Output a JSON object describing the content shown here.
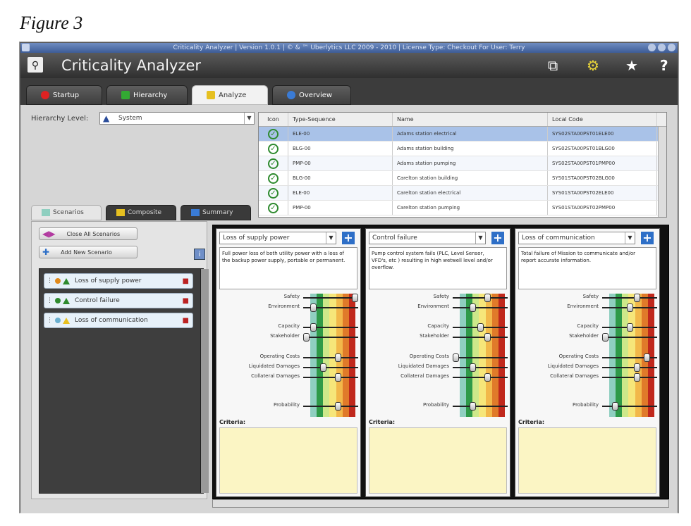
{
  "figure_caption": "Figure 3",
  "window": {
    "titlebar_text": "Criticality Analyzer  |  Version 1.0.1  |  © & ™ Uberlytics LLC 2009 - 2010  |  License Type: Checkout For User: Terry",
    "app_title": "Criticality Analyzer",
    "toolbar_icons": [
      "search-icon",
      "export-icon",
      "settings-gear-icon",
      "favorite-star-icon",
      "help-icon"
    ]
  },
  "main_tabs": [
    {
      "label": "Startup",
      "icon": "power-icon",
      "color": "#d22"
    },
    {
      "label": "Hierarchy",
      "icon": "hierarchy-icon",
      "color": "#3a3"
    },
    {
      "label": "Analyze",
      "icon": "analyze-icon",
      "color": "#e6c020",
      "active": true
    },
    {
      "label": "Overview",
      "icon": "overview-icon",
      "color": "#3a7bd5"
    }
  ],
  "hierarchy": {
    "label": "Hierarchy Level:",
    "selected": "System"
  },
  "grid": {
    "columns": [
      "Icon",
      "Type-Sequence",
      "Name",
      "Local Code"
    ],
    "rows": [
      {
        "type": "ELE-00",
        "name": "Adams station electrical",
        "code": "SYS02STA00PST01ELE00",
        "selected": true
      },
      {
        "type": "BLG-00",
        "name": "Adams station building",
        "code": "SYS02STA00PST01BLG00"
      },
      {
        "type": "PMP-00",
        "name": "Adams station pumping",
        "code": "SYS02STA00PST01PMP00"
      },
      {
        "type": "BLG-00",
        "name": "Carelton station building",
        "code": "SYS01STA00PST02BLG00"
      },
      {
        "type": "ELE-00",
        "name": "Carelton station electrical",
        "code": "SYS01STA00PST02ELE00"
      },
      {
        "type": "PMP-00",
        "name": "Carelton station pumping",
        "code": "SYS01STA00PST02PMP00"
      }
    ]
  },
  "subtabs": [
    {
      "label": "Scenarios",
      "active": true
    },
    {
      "label": "Composite"
    },
    {
      "label": "Summary"
    }
  ],
  "sidebar": {
    "close_all_label": "Close All Scenarios",
    "add_new_label": "Add New Scenario",
    "scenarios": [
      {
        "label": "Loss of supply power",
        "dot_color": "#e08a1c",
        "tri_color": "#2e8a2e"
      },
      {
        "label": "Control failure",
        "dot_color": "#2e8a2e",
        "tri_color": "#2e8a2e"
      },
      {
        "label": "Loss of communication",
        "dot_color": "#6ab0d0",
        "tri_color": "#e8c020"
      }
    ]
  },
  "slider_labels": [
    "Safety",
    "Environment",
    "Capacity",
    "Stakeholder",
    "Operating Costs",
    "Liquidated Damages",
    "Collateral Damages",
    "Probability"
  ],
  "criteria_label": "Criteria:",
  "panels": [
    {
      "selected": "Loss of supply power",
      "description": "Full power loss of both utility power with a loss of the backup power supply, portable or permanent.",
      "levels": [
        1.0,
        0.15,
        0.15,
        0.0,
        0.65,
        0.35,
        0.65,
        0.65
      ]
    },
    {
      "selected": "Control failure",
      "description": "Pump control system fails (PLC, Level Sensor, VFD's, etc ) resulting in high wetwell level and/or overflow.",
      "levels": [
        0.65,
        0.35,
        0.5,
        0.65,
        0.0,
        0.35,
        0.65,
        0.35
      ]
    },
    {
      "selected": "Loss of communication",
      "description": "Total failure of Mission to communicate and/or report accurate information.",
      "levels": [
        0.65,
        0.5,
        0.5,
        0.0,
        0.85,
        0.65,
        0.65,
        0.2
      ]
    }
  ],
  "risk_band_colors": [
    "#8fcfc0",
    "#2e9a48",
    "#cde88a",
    "#f6e67a",
    "#f2b84a",
    "#e07a2a",
    "#c0281c"
  ]
}
